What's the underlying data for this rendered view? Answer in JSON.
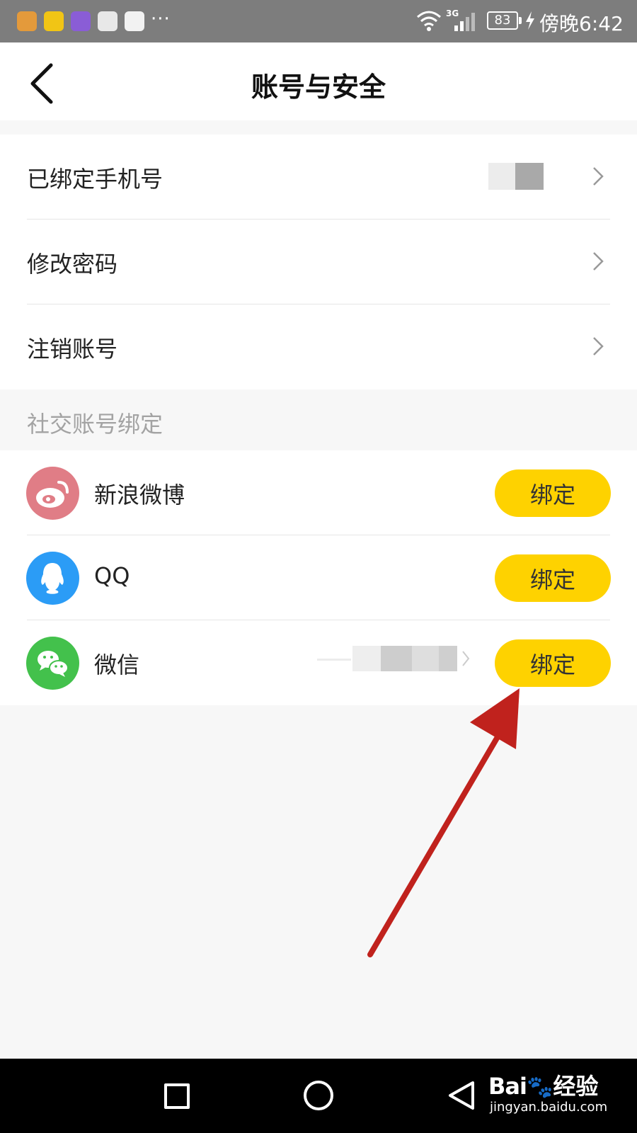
{
  "status_bar": {
    "more": "···",
    "battery": "83",
    "network": "3G",
    "time": "傍晚6:42"
  },
  "header": {
    "back_icon": "chevron-left-icon",
    "title": "账号与安全"
  },
  "account_section": {
    "items": [
      {
        "label": "已绑定手机号",
        "value_masked": true
      },
      {
        "label": "修改密码"
      },
      {
        "label": "注销账号"
      }
    ]
  },
  "social_section": {
    "title": "社交账号绑定",
    "items": [
      {
        "label": "新浪微博",
        "icon": "weibo-icon",
        "color": "#e07d86",
        "button": "绑定"
      },
      {
        "label": "QQ",
        "icon": "qq-icon",
        "color": "#2b9cf6",
        "button": "绑定"
      },
      {
        "label": "微信",
        "icon": "wechat-icon",
        "color": "#43c14c",
        "button": "绑定",
        "value_masked": true
      }
    ]
  },
  "annotation": {
    "color": "#c0221d"
  },
  "system_nav": {
    "recent_icon": "square-icon",
    "home_icon": "circle-icon",
    "back_icon": "triangle-back-icon"
  },
  "watermark": {
    "logo_text": "Bai",
    "logo_suffix": "经验",
    "url": "jingyan.baidu.com"
  }
}
